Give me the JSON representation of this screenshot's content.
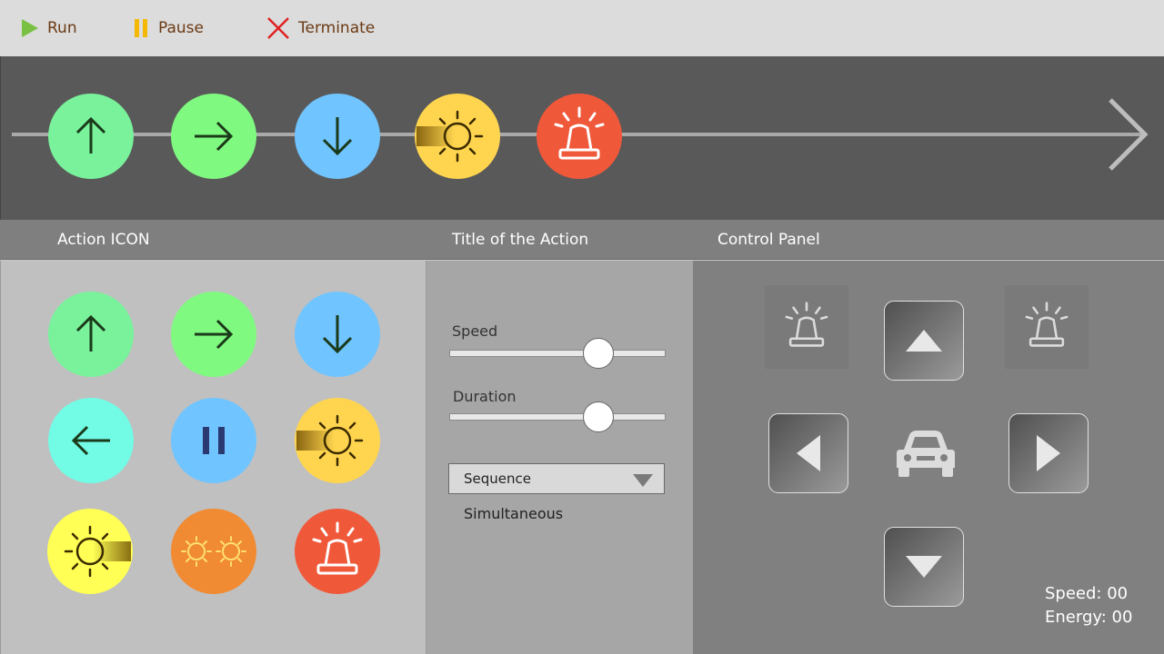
{
  "toolbar": {
    "run_label": "Run",
    "pause_label": "Pause",
    "terminate_label": "Terminate",
    "run_color": "#7ac143",
    "pause_color": "#f5b800",
    "terminate_color": "#e02020"
  },
  "timeline": {
    "items": [
      {
        "icon": "arrow-up-icon",
        "color": "#79f29b"
      },
      {
        "icon": "arrow-right-icon",
        "color": "#80f980"
      },
      {
        "icon": "arrow-down-icon",
        "color": "#70c4ff"
      },
      {
        "icon": "headlight-icon",
        "color": "#ffd54f"
      },
      {
        "icon": "siren-icon",
        "color": "#f0583a"
      }
    ]
  },
  "header": {
    "col1": "Action ICON",
    "col2": "Title of the Action",
    "col3": "Control Panel"
  },
  "palette": {
    "items": [
      {
        "icon": "arrow-up-icon",
        "color": "#79f29b"
      },
      {
        "icon": "arrow-right-icon",
        "color": "#80f980"
      },
      {
        "icon": "arrow-down-icon",
        "color": "#70c4ff"
      },
      {
        "icon": "arrow-left-icon",
        "color": "#72fbe5"
      },
      {
        "icon": "pause-icon",
        "color": "#70c4ff"
      },
      {
        "icon": "headlight-icon",
        "color": "#ffd54f"
      },
      {
        "icon": "headlight-right-icon",
        "color": "#ffff55"
      },
      {
        "icon": "double-light-icon",
        "color": "#f08a33"
      },
      {
        "icon": "siren-icon",
        "color": "#f0583a"
      }
    ]
  },
  "action": {
    "speed_label": "Speed",
    "speed_value": 0.69,
    "duration_label": "Duration",
    "duration_value": 0.69,
    "mode_selected": "Sequence",
    "mode_other": "Simultaneous"
  },
  "control": {
    "speed_readout": "Speed: 00",
    "energy_readout": "Energy: 00",
    "icons": [
      "siren-icon",
      "up-triangle-icon",
      "siren-icon",
      "left-triangle-icon",
      "car-icon",
      "right-triangle-icon",
      "down-triangle-icon"
    ]
  }
}
